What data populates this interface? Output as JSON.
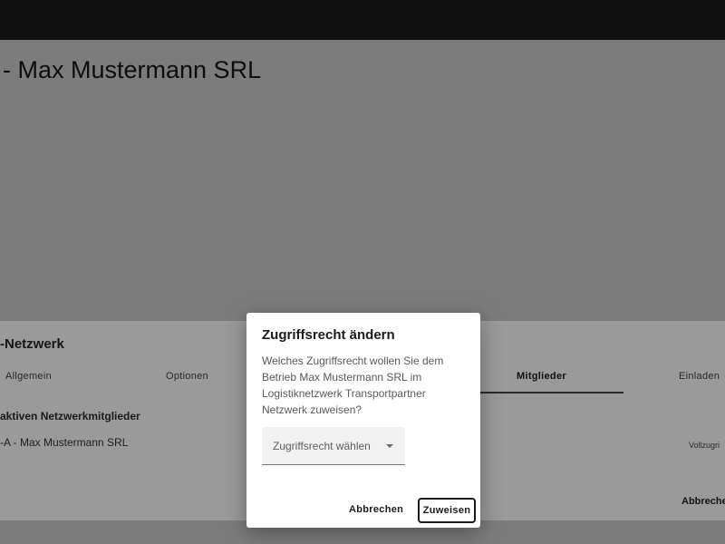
{
  "page": {
    "title": "- Max Mustermann SRL"
  },
  "card": {
    "title": "-Netzwerk",
    "tabs": [
      {
        "label": "Allgemein"
      },
      {
        "label": "Optionen"
      },
      {
        "label": "Mitglieder"
      },
      {
        "label": "Einladen"
      }
    ],
    "active_tab": "Mitglieder",
    "section_label": "aktiven Netzwerkmitglieder",
    "member_row": "-A - Max Mustermann SRL",
    "access_label": "Vollzugri",
    "cancel_label": "Abbreche"
  },
  "dialog": {
    "title": "Zugriffsrecht ändern",
    "text": "Welches Zugriffsrecht wollen Sie dem Betrieb Max Mustermann SRL im Logistiknetzwerk Transportpartner Netzwerk zuweisen?",
    "select": {
      "value": "Zugriffsrecht wählen",
      "icon": "caret-down-icon"
    },
    "cancel_label": "Abbrechen",
    "assign_label": "Zuweisen"
  },
  "colors": {
    "topbar": "#101010",
    "backdrop": "#7c7c7c",
    "card": "#9a9a9a",
    "dialog": "#ffffff"
  }
}
